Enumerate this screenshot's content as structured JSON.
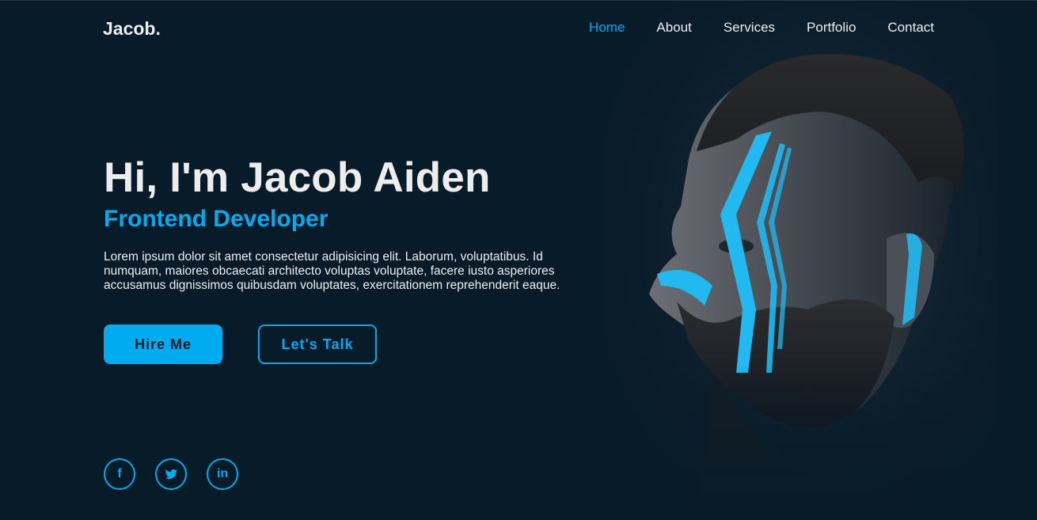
{
  "header": {
    "logo": "Jacob.",
    "nav": [
      {
        "label": "Home",
        "active": true
      },
      {
        "label": "About",
        "active": false
      },
      {
        "label": "Services",
        "active": false
      },
      {
        "label": "Portfolio",
        "active": false
      },
      {
        "label": "Contact",
        "active": false
      }
    ]
  },
  "hero": {
    "title": "Hi, I'm Jacob Aiden",
    "subtitle": "Frontend Developer",
    "description": "Lorem ipsum dolor sit amet consectetur adipisicing elit. Laborum, voluptatibus. Id numquam, maiores obcaecati architecto voluptas voluptate, facere iusto asperiores accusamus dignissimos quibusdam voluptates, exercitationem reprehenderit eaque.",
    "primary_button": "Hire Me",
    "secondary_button": "Let's Talk"
  },
  "socials": [
    {
      "icon": "facebook-icon",
      "glyph": "f"
    },
    {
      "icon": "twitter-icon",
      "glyph": ""
    },
    {
      "icon": "linkedin-icon",
      "glyph": "in"
    }
  ],
  "colors": {
    "background": "#081b29",
    "accent": "#00abf0",
    "text": "#ededed"
  }
}
